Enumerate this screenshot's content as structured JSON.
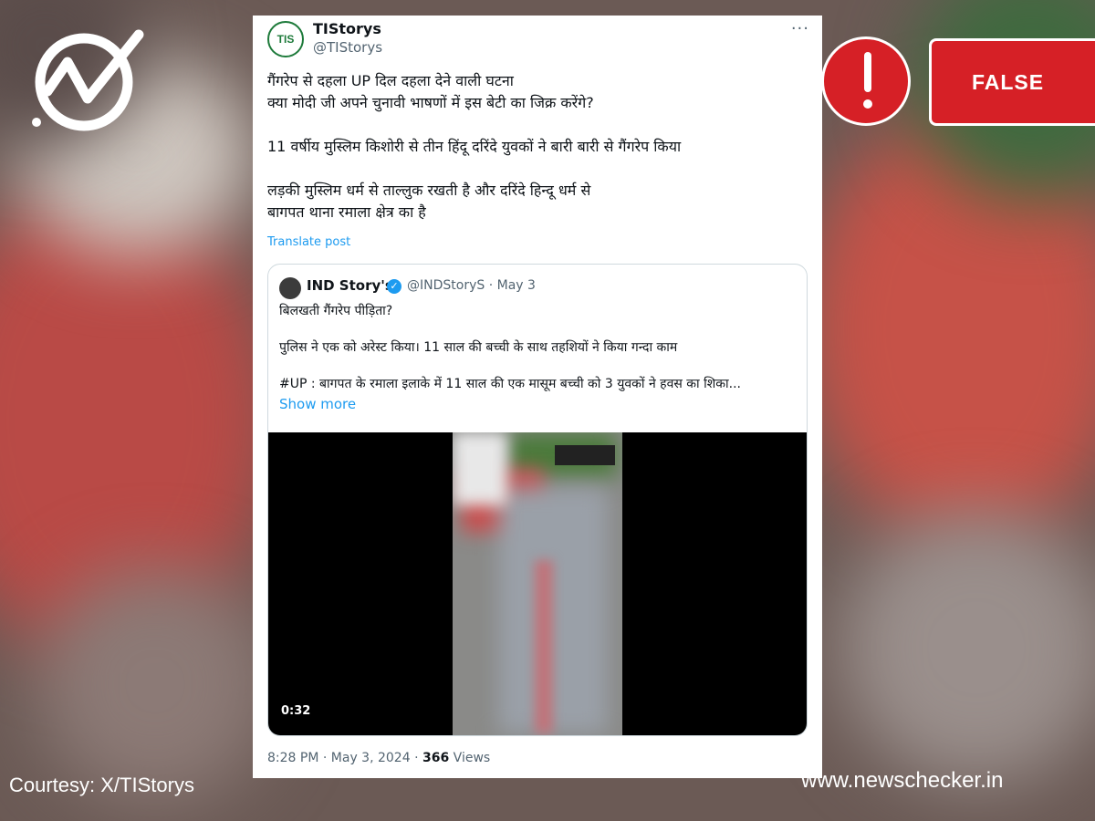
{
  "overlay": {
    "verdict": "FALSE",
    "courtesy": "Courtesy: X/TIStorys",
    "website": "www.newschecker.in",
    "accent_color": "#d62026"
  },
  "tweet": {
    "display_name": "TIStorys",
    "handle": "@TIStorys",
    "avatar_text": "TIS",
    "lines": [
      "गैंगरेप से दहला UP दिल दहला देने वाली घटना",
      "क्या मोदी जी अपने चुनावी भाषणों में इस बेटी का जिक्र करेंगे?",
      "11 वर्षीय मुस्लिम किशोरी से तीन हिंदू दरिंदे युवकों ने बारी बारी से गैंगरेप किया",
      "लड़की मुस्लिम धर्म से ताल्लुक रखती है और दरिंदे हिन्दू धर्म से",
      "बागपत थाना रमाला क्षेत्र का है"
    ],
    "translate_label": "Translate post",
    "time": "8:28 PM",
    "date": "May 3, 2024",
    "views": "366",
    "views_label": "Views"
  },
  "quoted_tweet": {
    "display_name": "IND Story's",
    "handle": "@INDStoryS",
    "date": "May 3",
    "lines": [
      "बिलखती गैंगरेप पीड़िता?",
      "पुलिस ने एक को अरेस्ट किया। 11 साल की बच्ची के साथ तहशियों ने किया गन्दा काम",
      "#UP : बागपत के रमाला इलाके में 11 साल की एक मासूम बच्ची को 3 युवकों ने हवस का शिका..."
    ],
    "show_more": "Show more",
    "video_duration": "0:32"
  }
}
